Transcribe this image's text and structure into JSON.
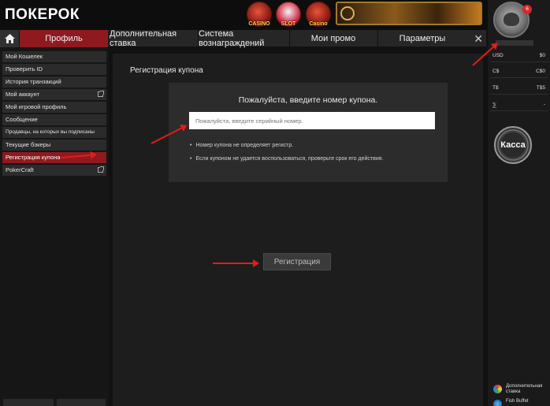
{
  "header": {
    "logo": "ПОКЕРОК",
    "games": [
      {
        "label": "CASINO",
        "icon": "casino-icon"
      },
      {
        "label": "SLOT",
        "icon": "slot-icon"
      },
      {
        "label": "Casino",
        "icon": "live-casino-icon"
      }
    ]
  },
  "nav": {
    "home_icon": "home-icon",
    "tabs": [
      {
        "label": "Профиль",
        "active": true
      },
      {
        "label": "Дополнительная ставка"
      },
      {
        "label": "Система вознаграждений"
      },
      {
        "label": "Мои промо"
      },
      {
        "label": "Параметры"
      }
    ],
    "close": "✕"
  },
  "sidebar": {
    "items": [
      {
        "label": "Мой Кошелек"
      },
      {
        "label": "Проверить ID"
      },
      {
        "label": "История транзакций"
      },
      {
        "label": "Мой аккаунт",
        "external": true
      },
      {
        "label": "Мой игровой профиль"
      },
      {
        "label": "Сообщение"
      },
      {
        "label": "Продавцы, на которых вы подписаны"
      },
      {
        "label": "Текущие бэкеры"
      },
      {
        "label": "Регистрация купона",
        "active": true
      },
      {
        "label": "PokerCraft",
        "external": true
      }
    ]
  },
  "main": {
    "section_title": "Регистрация купона",
    "panel_title": "Пожалуйста, введите номер купона.",
    "input_placeholder": "Пожалуйста, введите серийный номер.",
    "notes": [
      "Номер купона не определяет регистр.",
      "Если купоном не удается воспользоваться, проверьте срок его действия."
    ],
    "register_button": "Регистрация"
  },
  "right_panel": {
    "badge": "6",
    "balances": [
      {
        "currency": "USD",
        "value": "$0"
      },
      {
        "currency": "C$",
        "value": "C$0"
      },
      {
        "currency": "T$",
        "value": "T$5"
      },
      {
        "currency": "⅀",
        "value": "-"
      }
    ],
    "cashier": "Касса",
    "promos": [
      {
        "label": "Дополнительная ставка"
      },
      {
        "label": "Fish Buffet"
      }
    ]
  },
  "colors": {
    "accent_red": "#8e1a1f",
    "annotation_arrow": "#e51b1b"
  }
}
